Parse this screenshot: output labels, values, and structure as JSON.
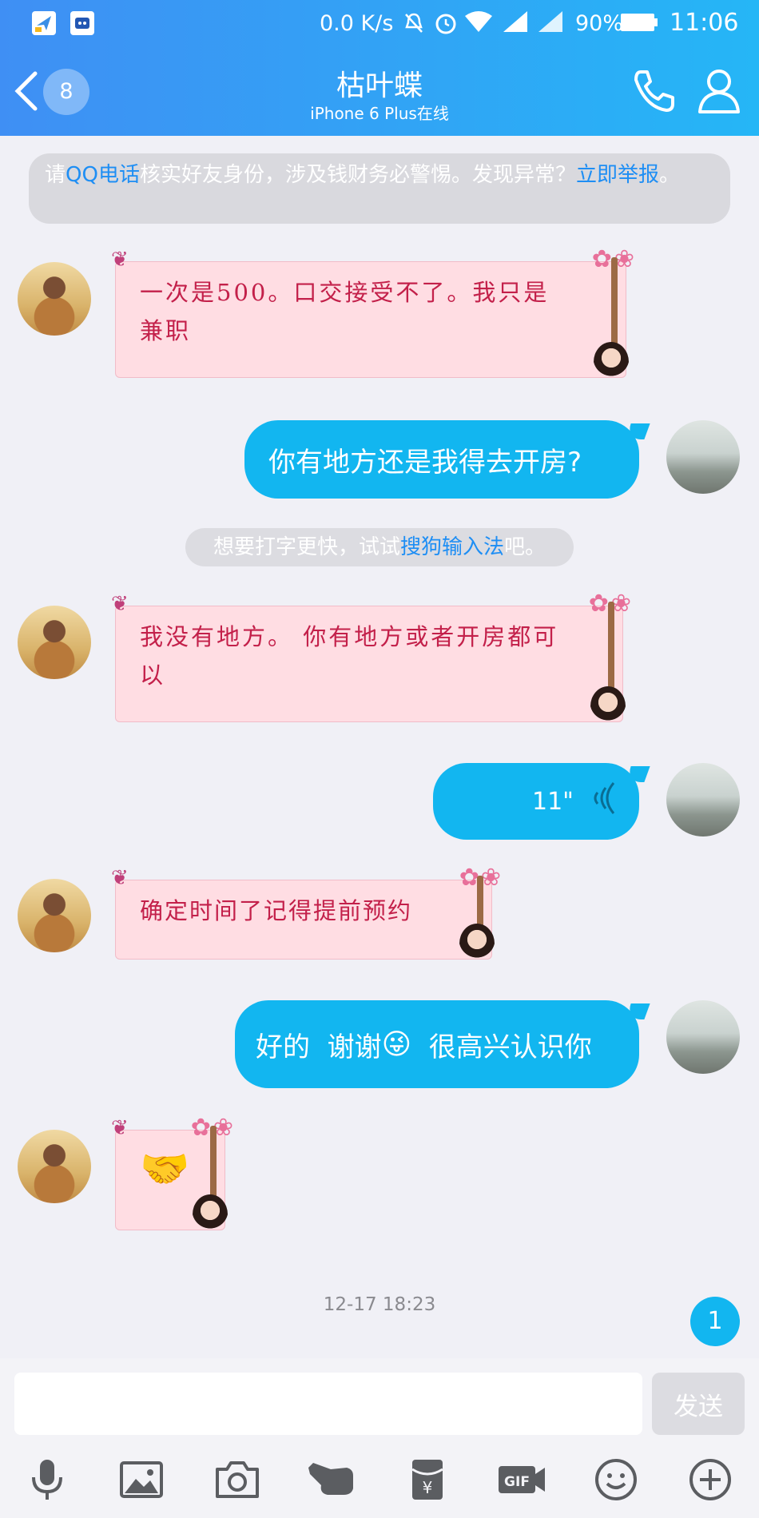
{
  "status_bar": {
    "net_speed": "0.0 K/s",
    "battery": "90%",
    "time": "11:06"
  },
  "header": {
    "back_count": "8",
    "title": "枯叶蝶",
    "subtitle": "iPhone 6 Plus在线"
  },
  "notice": {
    "part1": "请",
    "link1": "QQ电话",
    "part2": "核实好友身份，涉及钱财务必警惕。发现异常？",
    "link2": "立即举报",
    "part3": "。"
  },
  "messages": [
    {
      "from": "her",
      "text": "一次是500。口交接受不了。我只是兼职"
    },
    {
      "from": "me",
      "text": "你有地方还是我得去开房?"
    },
    {
      "system": true,
      "part1": "想要打字更快，试试",
      "link": "搜狗输入法",
      "part2": "吧。"
    },
    {
      "from": "her",
      "text": "我没有地方。 你有地方或者开房都可以"
    },
    {
      "from": "me",
      "voice": "11\""
    },
    {
      "from": "her",
      "text": "确定时间了记得提前预约"
    },
    {
      "from": "me",
      "text_a": "好的  谢谢",
      "emoji": "😜",
      "text_b": "  很高兴认识你"
    },
    {
      "from": "her",
      "sticker": "🤝"
    }
  ],
  "timestamp": "12-17 18:23",
  "unread_count": "1",
  "input": {
    "placeholder": "",
    "send_label": "发送"
  },
  "toolbar": [
    "microphone-icon",
    "image-icon",
    "camera-icon",
    "hand-icon",
    "red-packet-icon",
    "gif-icon",
    "emoji-icon",
    "plus-icon"
  ]
}
